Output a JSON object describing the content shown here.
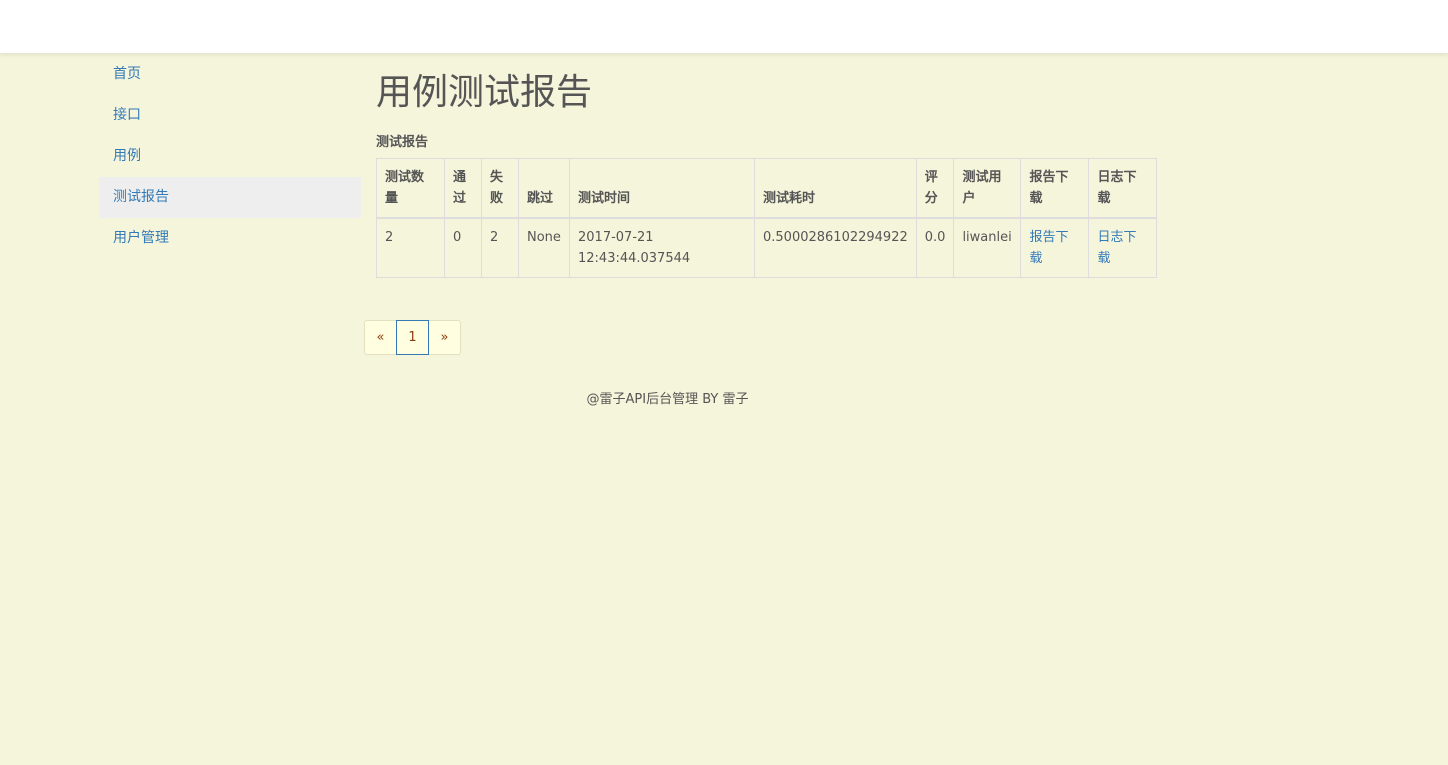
{
  "sidebar": {
    "items": [
      {
        "label": "首页"
      },
      {
        "label": "接口"
      },
      {
        "label": "用例"
      },
      {
        "label": "测试报告"
      },
      {
        "label": "用户管理"
      }
    ]
  },
  "main": {
    "title": "用例测试报告",
    "section_title": "测试报告",
    "table": {
      "headers": [
        "测试数量",
        "通过",
        "失败",
        "跳过",
        "测试时间",
        "测试耗时",
        "评分",
        "测试用户",
        "报告下载",
        "日志下载"
      ],
      "rows": [
        {
          "count": "2",
          "passed": "0",
          "failed": "2",
          "skipped": "None",
          "time": "2017-07-21 12:43:44.037544",
          "duration": "0.5000286102294922",
          "score": "0.0",
          "user": "liwanlei",
          "report_link": "报告下载",
          "log_link": "日志下载"
        }
      ]
    }
  },
  "pagination": {
    "prev": "«",
    "current": "1",
    "next": "»"
  },
  "footer": {
    "text": "@雷子API后台管理 BY 雷子"
  },
  "colors": {
    "background": "#f5f5dc",
    "link": "#337ab7",
    "active_nav": "#eeeeee"
  }
}
